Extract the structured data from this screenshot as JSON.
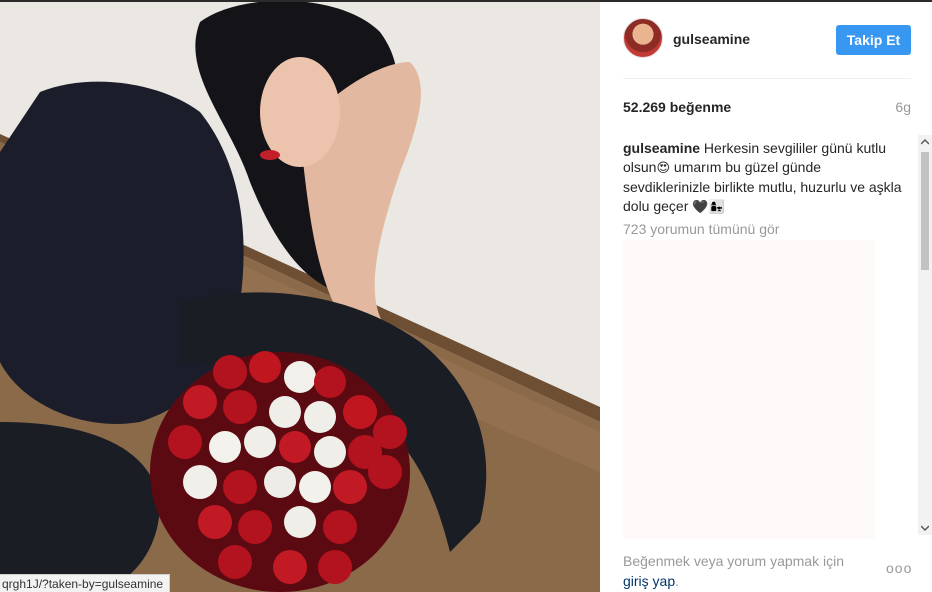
{
  "photo": {
    "status_url": "qrgh1J/?taken-by=gulseamine"
  },
  "post": {
    "username": "gulseamine",
    "follow_label": "Takip Et",
    "likes": "52.269 beğenme",
    "age": "6g",
    "caption": {
      "username": "gulseamine",
      "part1": "Herkesin sevgililer günü kutlu olsun",
      "emoji1": "😍",
      "part2": " umarım bu güzel günde sevdiklerinizle birlikte mutlu, huzurlu ve aşkla dolu geçer ",
      "emoji2": "🖤👩‍👧"
    },
    "view_all_comments": "723 yorumun tümünü gör",
    "footer_prompt": "Beğenmek veya yorum yapmak için",
    "login_label": "giriş yap",
    "login_suffix": ".",
    "more_label": "ooo"
  },
  "icons": {
    "scroll_up": "chevron-up-icon",
    "scroll_down": "chevron-down-icon",
    "more": "more-options-icon"
  },
  "colors": {
    "accent": "#3897f0",
    "text": "#262626",
    "muted": "#999999",
    "link": "#003569"
  }
}
